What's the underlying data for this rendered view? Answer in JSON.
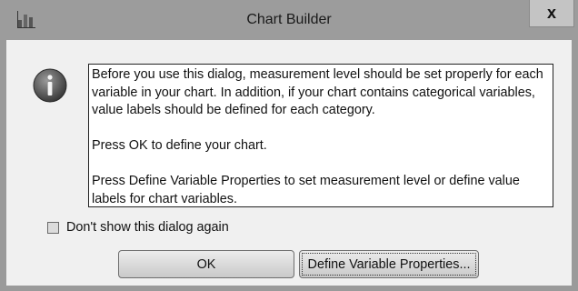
{
  "window": {
    "title": "Chart Builder",
    "close_label": "x"
  },
  "message": {
    "paragraphs": [
      "Before you use this dialog, measurement level should be set properly for each variable in your chart. In addition, if your chart contains categorical variables, value labels should be defined for each category.",
      "Press OK to define your chart.",
      "Press Define Variable Properties to set measurement level or define value labels for chart variables."
    ]
  },
  "checkbox": {
    "label": "Don't show this dialog again",
    "checked": false
  },
  "buttons": {
    "ok_label": "OK",
    "define_label": "Define Variable Properties..."
  },
  "icons": {
    "app": "chart-builder-app-icon",
    "info": "info-icon"
  }
}
